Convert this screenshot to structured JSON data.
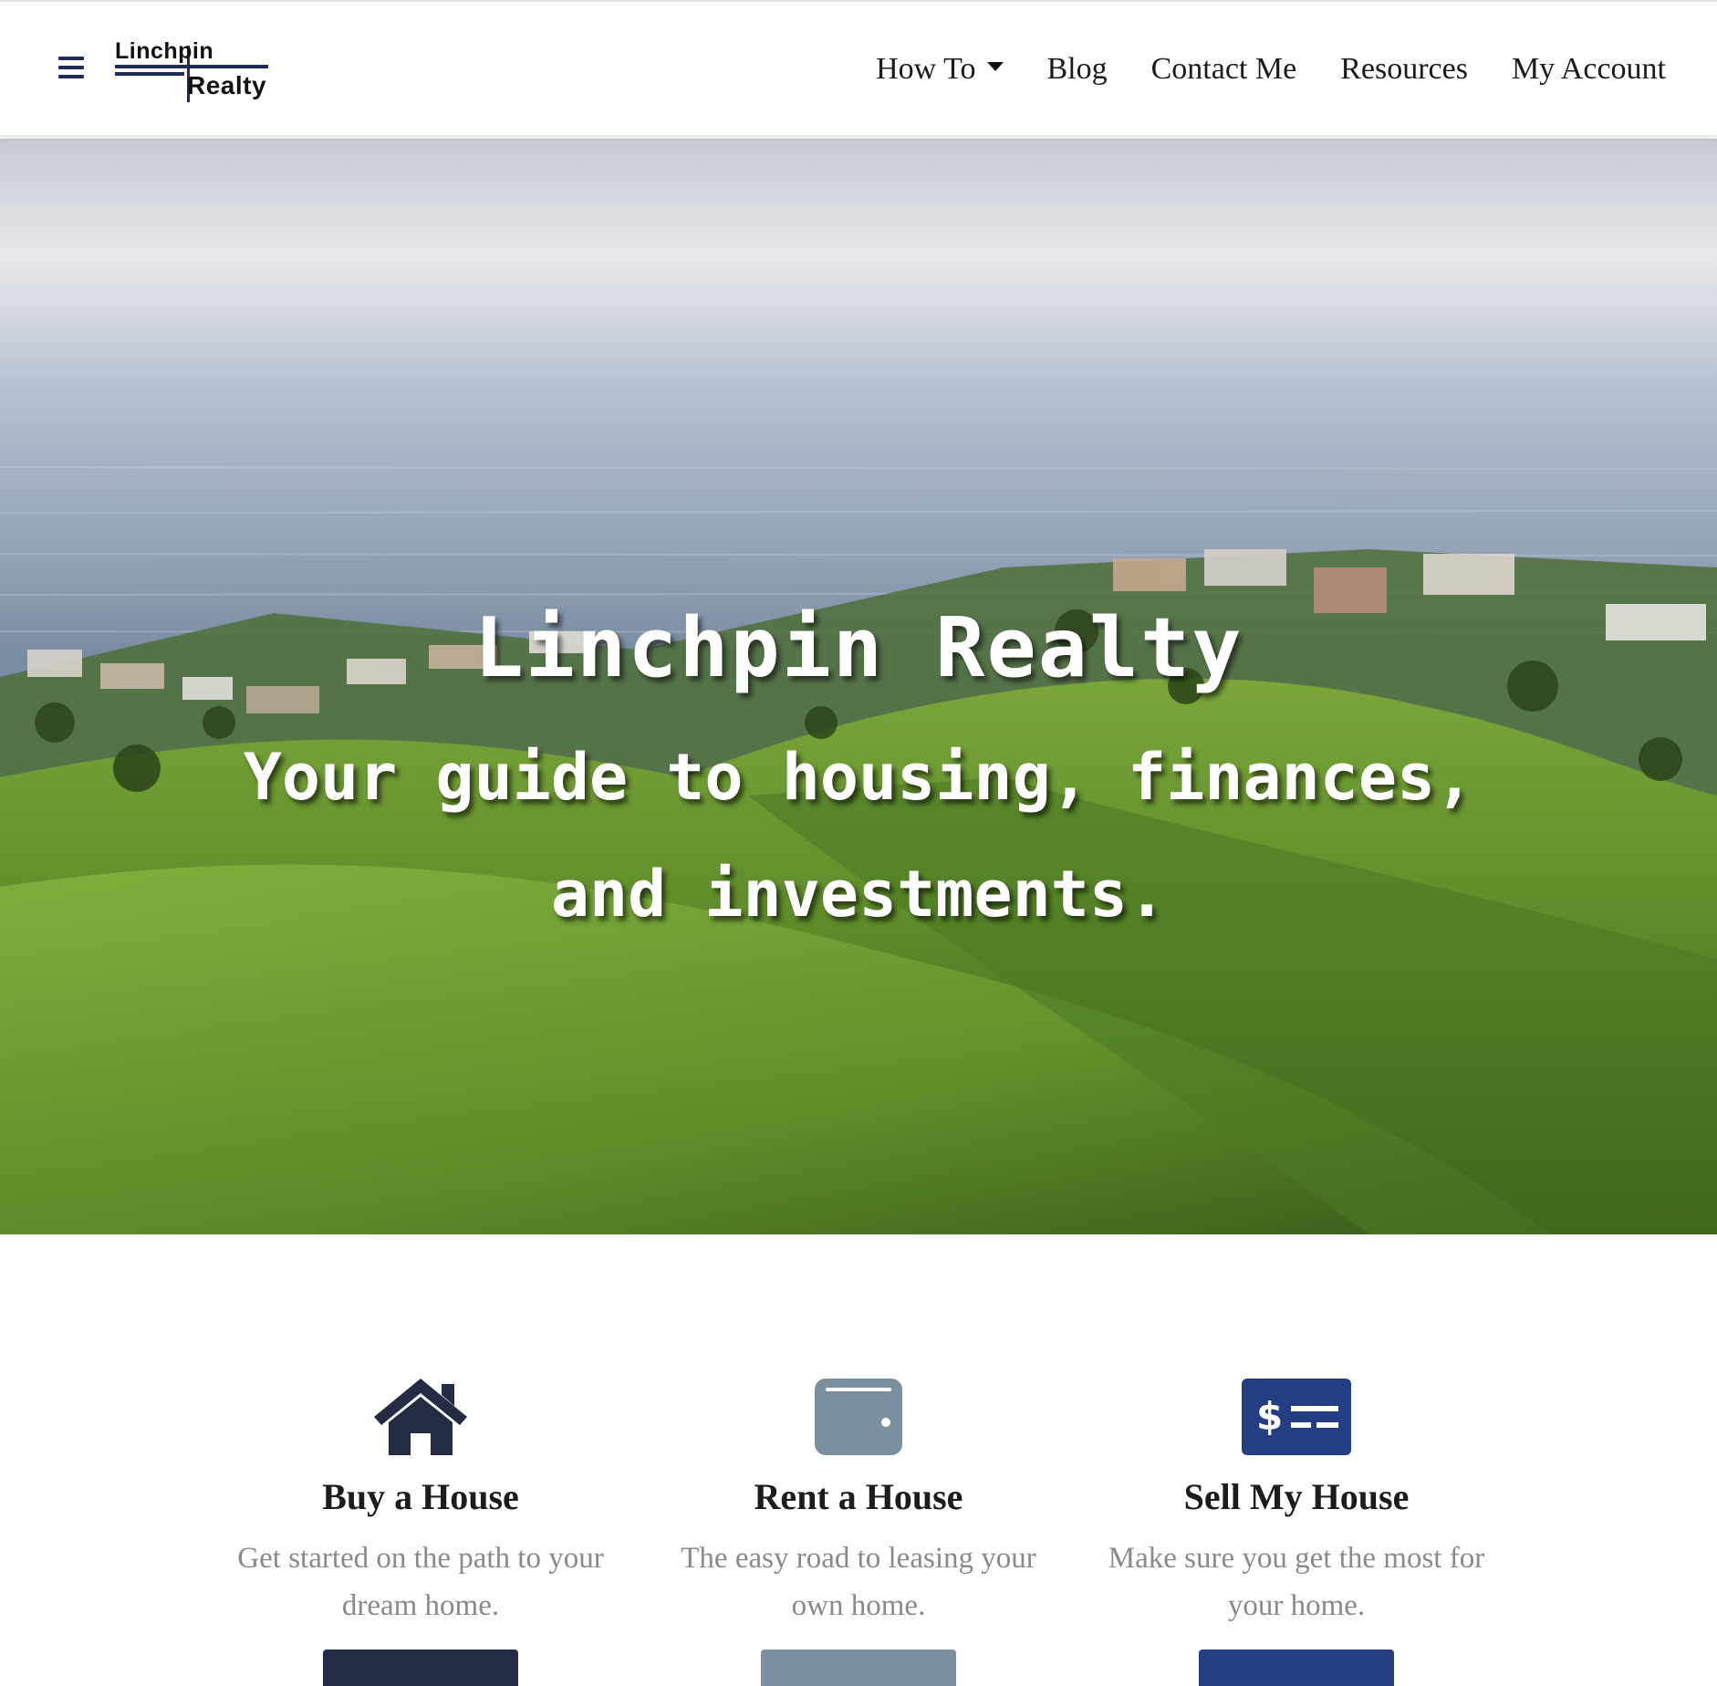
{
  "brand": {
    "logo_line1": "Linchpin",
    "logo_line2": "Realty",
    "navy": "#1f2c57",
    "accent_blue": "#233e82",
    "slate": "#7c8f9f"
  },
  "nav": {
    "menu_icon": "hamburger-icon",
    "items": [
      {
        "label": "How To",
        "dropdown": true
      },
      {
        "label": "Blog"
      },
      {
        "label": "Contact Me"
      },
      {
        "label": "Resources"
      },
      {
        "label": "My Account"
      }
    ]
  },
  "hero": {
    "title": "Linchpin Realty",
    "subtitle": "Your guide to housing, finances, and investments."
  },
  "services": [
    {
      "icon": "house-icon",
      "title": "Buy a House",
      "description": "Get started on the path to your dream home.",
      "button_color": "#242c45"
    },
    {
      "icon": "wallet-icon",
      "title": "Rent a House",
      "description": "The easy road to leasing your own home.",
      "button_color": "#7c8f9f"
    },
    {
      "icon": "money-check-icon",
      "title": "Sell My House",
      "description": "Make sure you get the most for your home.",
      "button_color": "#233e82"
    }
  ]
}
